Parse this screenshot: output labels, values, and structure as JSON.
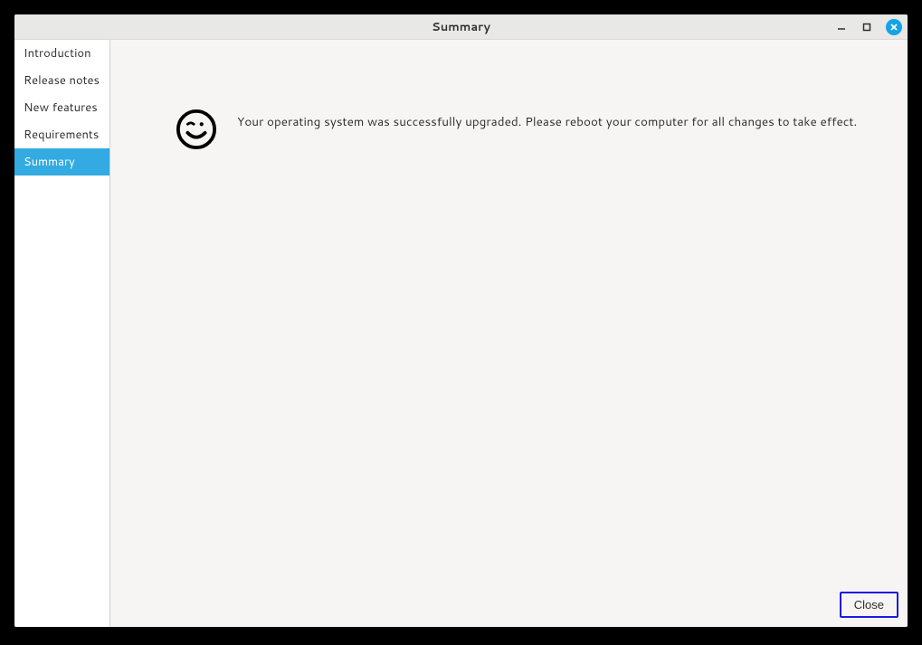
{
  "window": {
    "title": "Summary"
  },
  "sidebar": {
    "items": [
      {
        "label": "Introduction",
        "selected": false
      },
      {
        "label": "Release notes",
        "selected": false
      },
      {
        "label": "New features",
        "selected": false
      },
      {
        "label": "Requirements",
        "selected": false
      },
      {
        "label": "Summary",
        "selected": true
      }
    ]
  },
  "main": {
    "message": "Your operating system was successfully upgraded. Please reboot your computer for all changes to take effect."
  },
  "footer": {
    "close_label": "Close"
  }
}
